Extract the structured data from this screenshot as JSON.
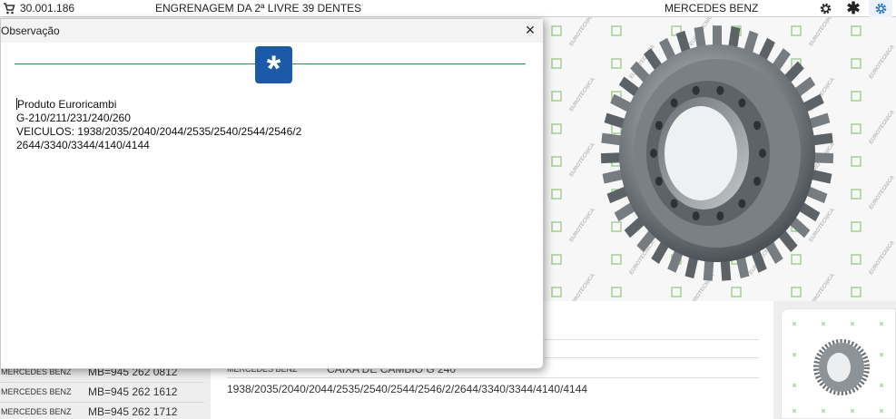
{
  "topbar": {
    "cart_icon": "cart-icon",
    "code": "30.001.186",
    "title": "ENGRENAGEM DA 2ª LIVRE 39 DENTES",
    "brand": "MERCEDES BENZ",
    "icons": [
      "gear-icon",
      "asterisk-icon",
      "settings-icon"
    ],
    "accent": "#1a6fd0"
  },
  "modal": {
    "title": "Observação",
    "close_label": "×",
    "badge_symbol": "*",
    "badge_color": "#1a5aa6",
    "rule_color": "#2e8a57",
    "lines": [
      "Produto Euroricambi",
      "",
      "G-210/211/231/240/260",
      "VEICULOS: 1938/2035/2040/2044/2535/2540/2544/2546/2",
      "2644/3340/3344/4140/4144"
    ]
  },
  "references": [
    {
      "brand": "MERCEDES BENZ",
      "code": "MB=945 262 0812"
    },
    {
      "brand": "MERCEDES BENZ",
      "code": "MB=945 262 1612"
    },
    {
      "brand": "MERCEDES BENZ",
      "code": "MB=945 262 1712"
    }
  ],
  "application": {
    "brand": "MERCEDES BENZ",
    "description": "CAIXA DE CÂMBIO G 240",
    "vehicles": "1938/2035/2040/2044/2535/2540/2544/2546/2/2644/3340/3344/4140/4144"
  },
  "watermark": {
    "text": "EUROTECNICA",
    "color": "#7fbf6a"
  }
}
